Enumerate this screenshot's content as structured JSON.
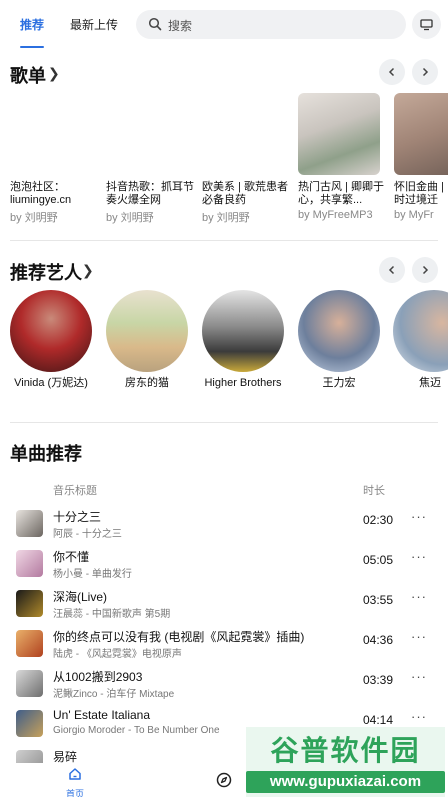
{
  "header": {
    "tabs": [
      "推荐",
      "最新上传"
    ],
    "search_placeholder": "搜索"
  },
  "playlists_section": {
    "title": "歌单",
    "items": [
      {
        "name": "泡泡社区：liumingye.cn",
        "by": "by 刘明野"
      },
      {
        "name": "抖音热歌：抓耳节奏火爆全网",
        "by": "by 刘明野"
      },
      {
        "name": "欧美系 | 歌荒患者必备良药",
        "by": "by 刘明野"
      },
      {
        "name": "热门古风 | 卿卿于心，共享繁...",
        "by": "by MyFreeMP3"
      },
      {
        "name": "怀旧金曲 | 时过境迁",
        "by": "by MyFr"
      }
    ]
  },
  "artists_section": {
    "title": "推荐艺人",
    "items": [
      {
        "name": "Vinida (万妮达)"
      },
      {
        "name": "房东的猫"
      },
      {
        "name": "Higher Brothers"
      },
      {
        "name": "王力宏"
      },
      {
        "name": "焦迈"
      }
    ]
  },
  "songs_section": {
    "title": "单曲推荐",
    "col_title": "音乐标题",
    "col_duration": "时长",
    "items": [
      {
        "title": "十分之三",
        "sub": "阿辰 - 十分之三",
        "duration": "02:30"
      },
      {
        "title": "你不懂",
        "sub": "杨小曼 - 单曲发行",
        "duration": "05:05"
      },
      {
        "title": "深海(Live)",
        "sub": "汪晨蕊 - 中国新歌声 第5期",
        "duration": "03:55"
      },
      {
        "title": "你的终点可以没有我 (电视剧《风起霓裳》插曲)",
        "sub": "陆虎 - 《风起霓裳》电视原声",
        "duration": "04:36"
      },
      {
        "title": "从1002搬到2903",
        "sub": "泥鳅Zinco - 泊车仔 Mixtape",
        "duration": "03:39"
      },
      {
        "title": "Un' Estate Italiana",
        "sub": "Giorgio Moroder - To Be Number One",
        "duration": "04:14"
      },
      {
        "title": "易碎",
        "sub": "",
        "duration": ""
      }
    ],
    "more_glyph": "···"
  },
  "bottom_nav": {
    "home_label": "首页"
  },
  "watermark": {
    "top": "谷普软件园",
    "bottom": "www.gupuxiazai.com"
  },
  "colors": {
    "accent": "#2b6fe0",
    "watermark_green": "#2ea35a"
  }
}
